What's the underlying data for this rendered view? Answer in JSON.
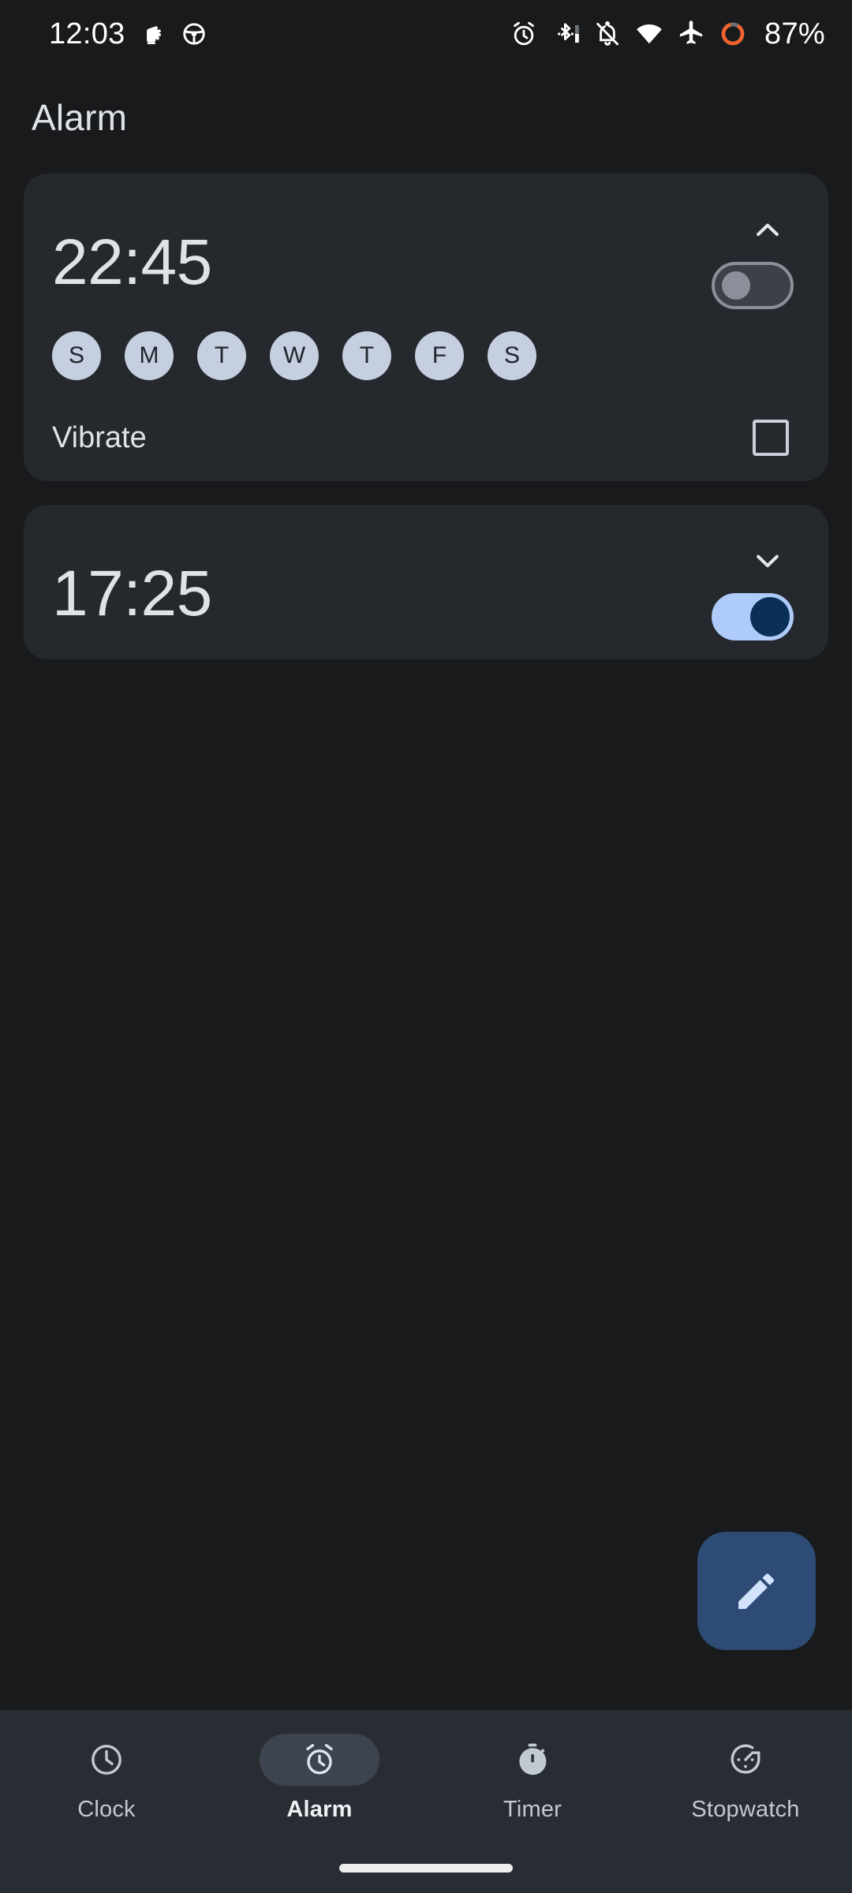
{
  "status_bar": {
    "time": "12:03",
    "left_icons": [
      {
        "name": "raised-fist-icon"
      },
      {
        "name": "steering-wheel-icon"
      }
    ],
    "right_icons": [
      {
        "name": "alarm-clock-icon"
      },
      {
        "name": "bluetooth-icon"
      },
      {
        "name": "notifications-off-icon"
      },
      {
        "name": "wifi-icon"
      },
      {
        "name": "airplane-mode-icon"
      },
      {
        "name": "battery-ring-icon"
      }
    ],
    "battery_percent": "87%",
    "battery_color": "#f4622e"
  },
  "header": {
    "title": "Alarm"
  },
  "alarms": [
    {
      "time": "22:45",
      "enabled": false,
      "expanded": true,
      "chevron": "chevron-up-icon",
      "days": [
        {
          "label": "S",
          "selected": true
        },
        {
          "label": "M",
          "selected": true
        },
        {
          "label": "T",
          "selected": true
        },
        {
          "label": "W",
          "selected": true
        },
        {
          "label": "T",
          "selected": true
        },
        {
          "label": "F",
          "selected": true
        },
        {
          "label": "S",
          "selected": true
        }
      ],
      "vibrate_label": "Vibrate",
      "vibrate_checked": false
    },
    {
      "time": "17:25",
      "enabled": true,
      "expanded": false,
      "chevron": "chevron-down-icon"
    }
  ],
  "fab": {
    "icon": "pencil-edit-icon",
    "background": "#2d4b74",
    "icon_color": "#d3e2fd"
  },
  "bottom_nav": {
    "items": [
      {
        "label": "Clock",
        "icon": "clock-icon",
        "active": false
      },
      {
        "label": "Alarm",
        "icon": "alarm-clock-icon",
        "active": true
      },
      {
        "label": "Timer",
        "icon": "timer-filled-icon",
        "active": false
      },
      {
        "label": "Stopwatch",
        "icon": "stopwatch-icon",
        "active": false
      }
    ]
  },
  "colors": {
    "page_background": "#191a1c",
    "card_background": "#25282d",
    "nav_background": "#282d33",
    "toggle_on_track": "#aecbfa",
    "toggle_on_thumb": "#0a3055",
    "toggle_off_track": "#3c4049",
    "day_chip": "#c5cfe0",
    "text_primary": "#dfe2e6"
  }
}
